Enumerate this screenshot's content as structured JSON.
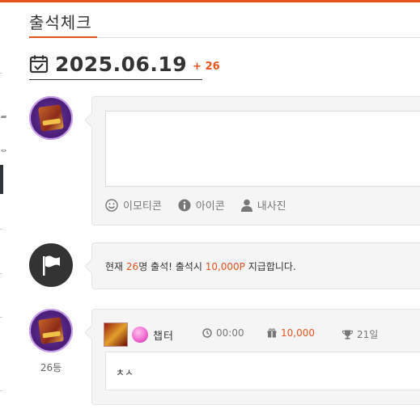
{
  "page": {
    "title": "출석체크"
  },
  "date": {
    "value": "2025.06.19",
    "plus": "+ 26"
  },
  "composer": {
    "tools": [
      {
        "label": "이모티콘",
        "icon": "smile-icon"
      },
      {
        "label": "아이콘",
        "icon": "info-icon"
      },
      {
        "label": "내사진",
        "icon": "user-icon"
      }
    ]
  },
  "notice": {
    "pre": "현재 ",
    "count": "26",
    "mid": "명 출석! 출석시 ",
    "points": "10,000P",
    "post": " 지급합니다."
  },
  "entry": {
    "rank": "26등",
    "nickname": "챕터",
    "time": "00:00",
    "points": "10,000",
    "days": "21일",
    "message": "ㅊㅅ"
  },
  "colors": {
    "accent": "#e5541f",
    "dark": "#333333",
    "card": "#f5f5f5"
  }
}
